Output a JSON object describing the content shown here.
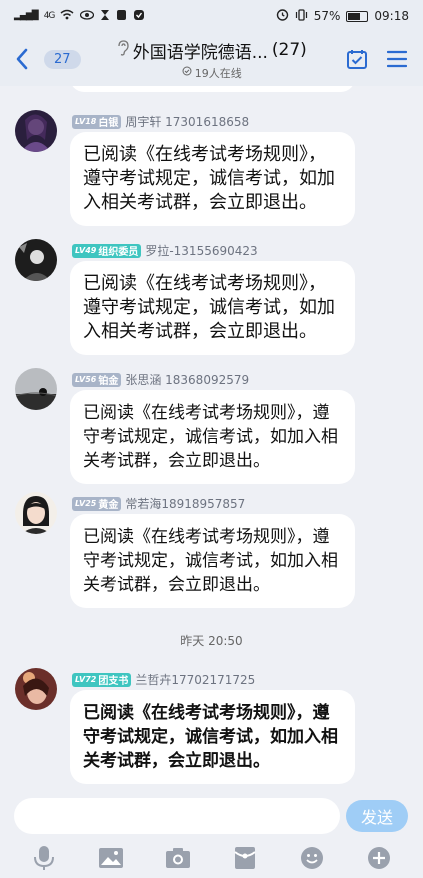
{
  "statusbar": {
    "net": "4G",
    "battery": "57%",
    "time": "09:18"
  },
  "header": {
    "unread_count": "27",
    "title": "外国语学院德语...",
    "member_count": "(27)",
    "online": "19人在线"
  },
  "messages": [
    {
      "level": "LV18",
      "title": "白银",
      "badge_color": "#a8b4c8",
      "sender": "周宇轩 17301618658",
      "text": "已阅读《在线考试考场规则》，遵守考试规定，诚信考试，如加入相关考试群，会立即退出。"
    },
    {
      "level": "LV49",
      "title": "组织委员",
      "badge_color": "#3fc5c0",
      "sender": "罗拉-13155690423",
      "text": "已阅读《在线考试考场规则》，遵守考试规定，诚信考试，如加入相关考试群，会立即退出。"
    },
    {
      "level": "LV56",
      "title": "铂金",
      "badge_color": "#a8b4c8",
      "sender": "张思涵 18368092579",
      "text": "已阅读《在线考试考场规则》，遵守考试规定，诚信考试，如加入相关考试群，会立即退出。"
    },
    {
      "level": "LV25",
      "title": "黄金",
      "badge_color": "#a8b4c8",
      "sender": "常若海18918957857",
      "text": "已阅读《在线考试考场规则》，遵守考试规定，诚信考试，如加入相关考试群，会立即退出。"
    },
    {
      "level": "LV72",
      "title": "团支书",
      "badge_color": "#3fc5c0",
      "sender": "兰哲卉17702171725",
      "text": "已阅读《在线考试考场规则》，遵守考试规定，诚信考试，如加入相关考试群，会立即退出。"
    }
  ],
  "timestamp": "昨天 20:50",
  "composer": {
    "send_label": "发送"
  },
  "colors": {
    "accent": "#2b6bd1",
    "send_button": "#9fcdf6",
    "background": "#eef0f5"
  }
}
